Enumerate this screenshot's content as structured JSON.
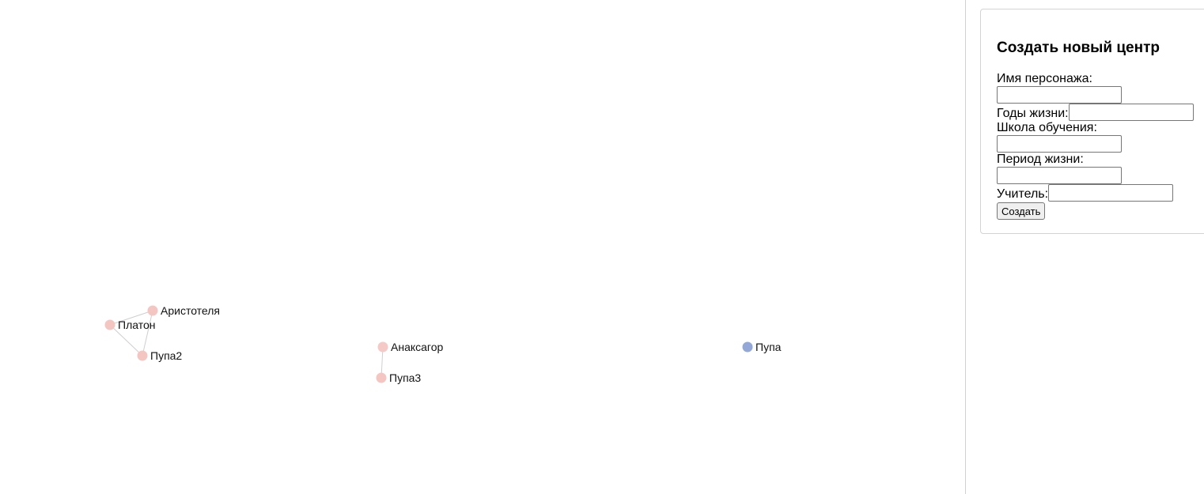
{
  "graph": {
    "nodes": [
      {
        "id": "aristotle",
        "label": "Аристотеля",
        "color": "#f4c6c2"
      },
      {
        "id": "platon",
        "label": "Платон",
        "color": "#f4c6c2"
      },
      {
        "id": "pupa2",
        "label": "Пупа2",
        "color": "#f4c6c2"
      },
      {
        "id": "anaxagoras",
        "label": "Анаксагор",
        "color": "#f4c9c6"
      },
      {
        "id": "pupa3",
        "label": "Пупа3",
        "color": "#f4c6c2"
      },
      {
        "id": "pupa",
        "label": "Пупа",
        "color": "#93a8d6"
      }
    ],
    "edges": [
      {
        "source": "platon",
        "target": "aristotle"
      },
      {
        "source": "platon",
        "target": "pupa2"
      },
      {
        "source": "aristotle",
        "target": "pupa2"
      },
      {
        "source": "anaxagoras",
        "target": "pupa3"
      }
    ]
  },
  "form": {
    "title": "Создать новый центр",
    "fields": {
      "name": {
        "label": "Имя персонажа:",
        "value": ""
      },
      "years": {
        "label": "Годы жизни:",
        "value": ""
      },
      "school": {
        "label": "Школа обучения:",
        "value": ""
      },
      "period": {
        "label": "Период жизни:",
        "value": ""
      },
      "teacher": {
        "label": "Учитель:",
        "value": ""
      }
    },
    "submit_label": "Создать"
  }
}
